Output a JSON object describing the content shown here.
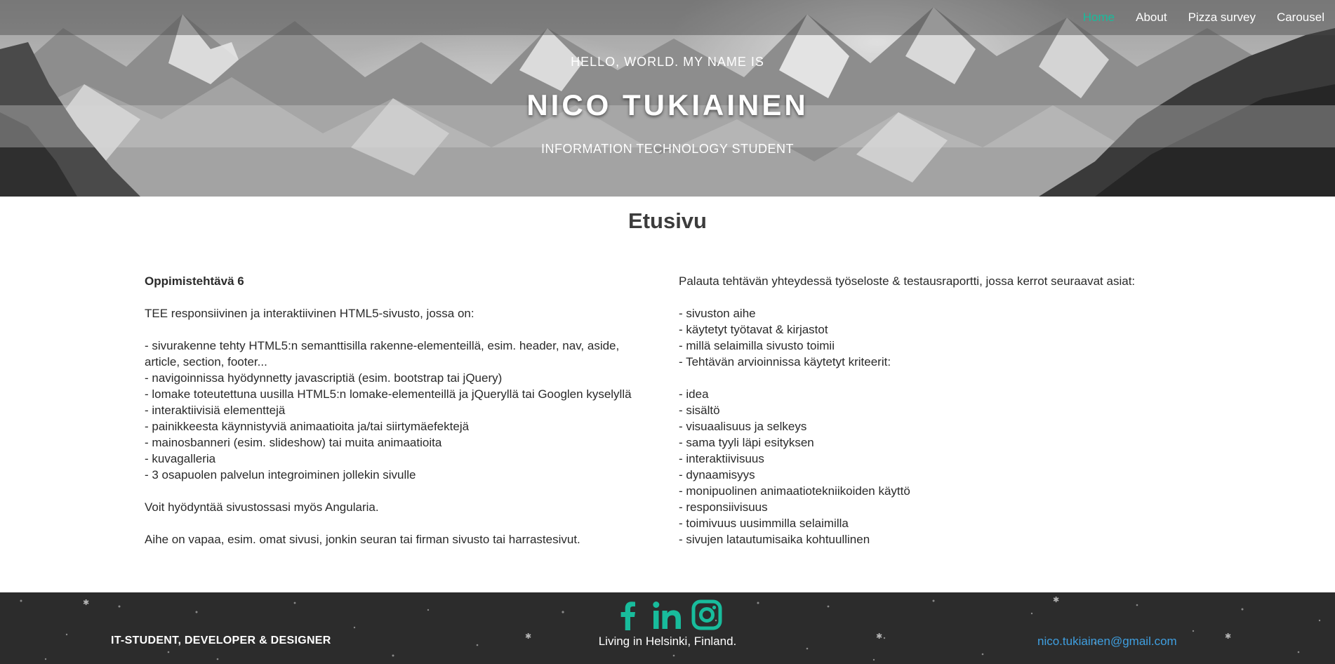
{
  "nav": {
    "items": [
      {
        "label": "Home",
        "active": true
      },
      {
        "label": "About",
        "active": false
      },
      {
        "label": "Pizza survey",
        "active": false
      },
      {
        "label": "Carousel",
        "active": false
      }
    ]
  },
  "hero": {
    "greeting": "HELLO, WORLD. MY NAME IS",
    "name": "NICO TUKIAINEN",
    "role": "INFORMATION TECHNOLOGY STUDENT"
  },
  "main": {
    "title": "Etusivu",
    "left": {
      "heading": "Oppimistehtävä 6",
      "intro": "TEE responsiivinen ja interaktiivinen HTML5-sivusto, jossa on:",
      "list": [
        "- sivurakenne tehty HTML5:n semanttisilla rakenne-elementeillä, esim. header, nav, aside, article, section, footer...",
        "- navigoinnissa hyödynnetty javascriptiä (esim. bootstrap tai jQuery)",
        "- lomake toteutettuna uusilla HTML5:n lomake-elementeillä ja jQueryllä tai Googlen kyselyllä",
        "- interaktiivisiä elementtejä",
        "- painikkeesta käynnistyviä animaatioita ja/tai siirtymäefektejä",
        "- mainosbanneri (esim. slideshow) tai muita animaatioita",
        "- kuvagalleria",
        "- 3 osapuolen palvelun integroiminen jollekin sivulle"
      ],
      "note1": "Voit hyödyntää sivustossasi myös Angularia.",
      "note2": "Aihe on vapaa, esim. omat sivusi, jonkin seuran tai firman sivusto tai harrastesivut."
    },
    "right": {
      "intro": "Palauta tehtävän yhteydessä työseloste & testausraportti, jossa kerrot seuraavat asiat:",
      "list1": [
        "- sivuston aihe",
        "- käytetyt työtavat & kirjastot",
        "- millä selaimilla sivusto toimii",
        "- Tehtävän arvioinnissa käytetyt kriteerit:"
      ],
      "list2": [
        "- idea",
        "- sisältö",
        "- visuaalisuus ja selkeys",
        "- sama tyyli läpi esityksen",
        "- interaktiivisuus",
        "- dynaamisyys",
        "- monipuolinen animaatiotekniikoiden käyttö",
        "- responsiivisuus",
        "- toimivuus uusimmilla selaimilla",
        "- sivujen latautumisaika kohtuullinen"
      ]
    }
  },
  "footer": {
    "left": "IT-STUDENT, DEVELOPER & DESIGNER",
    "center": "Living in Helsinki, Finland.",
    "email": "nico.tukiainen@gmail.com",
    "social": [
      "facebook-icon",
      "linkedin-icon",
      "instagram-icon"
    ],
    "accent": "#18bc9c"
  },
  "colors": {
    "nav_active": "#18bc9c",
    "footer_bg": "#2c2c2c",
    "email_link": "#3f9fe0"
  }
}
